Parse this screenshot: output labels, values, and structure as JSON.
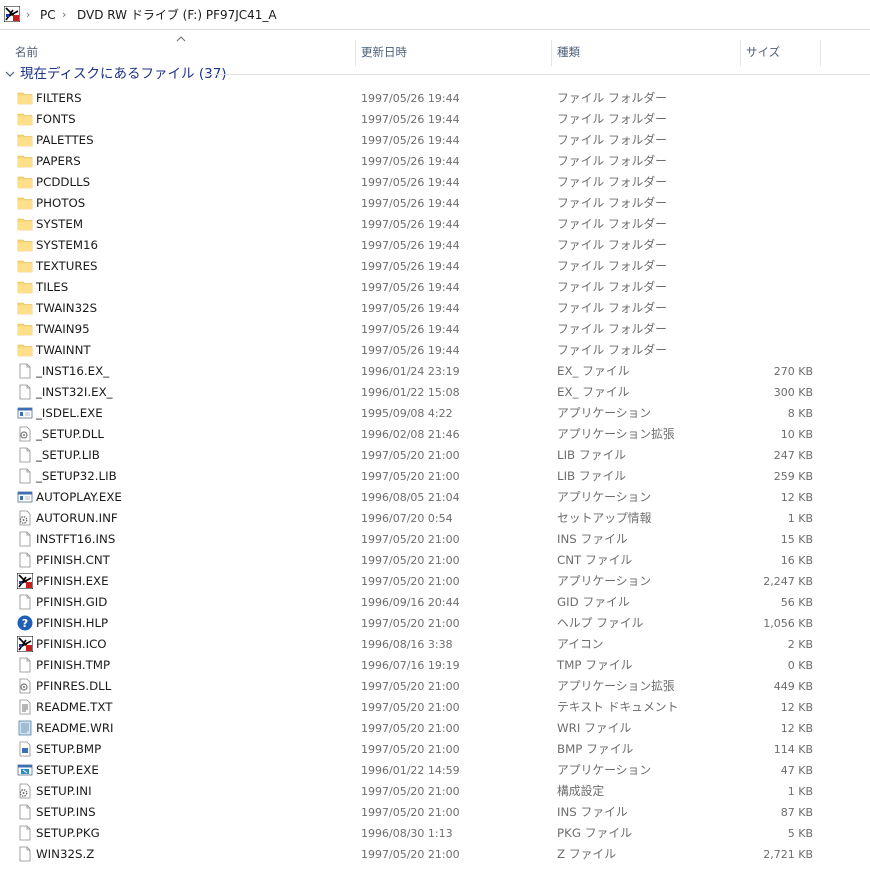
{
  "address": {
    "crumbs": [
      "PC",
      "DVD RW ドライブ (F:) PF97JC41_A"
    ]
  },
  "columns": {
    "name": "名前",
    "modified": "更新日時",
    "type": "種類",
    "size": "サイズ"
  },
  "group": {
    "title": "現在ディスクにあるファイル (37)"
  },
  "files": [
    {
      "name": "FILTERS",
      "date": "1997/05/26 19:44",
      "type": "ファイル フォルダー",
      "size": "",
      "icon": "folder"
    },
    {
      "name": "FONTS",
      "date": "1997/05/26 19:44",
      "type": "ファイル フォルダー",
      "size": "",
      "icon": "folder"
    },
    {
      "name": "PALETTES",
      "date": "1997/05/26 19:44",
      "type": "ファイル フォルダー",
      "size": "",
      "icon": "folder"
    },
    {
      "name": "PAPERS",
      "date": "1997/05/26 19:44",
      "type": "ファイル フォルダー",
      "size": "",
      "icon": "folder"
    },
    {
      "name": "PCDDLLS",
      "date": "1997/05/26 19:44",
      "type": "ファイル フォルダー",
      "size": "",
      "icon": "folder"
    },
    {
      "name": "PHOTOS",
      "date": "1997/05/26 19:44",
      "type": "ファイル フォルダー",
      "size": "",
      "icon": "folder"
    },
    {
      "name": "SYSTEM",
      "date": "1997/05/26 19:44",
      "type": "ファイル フォルダー",
      "size": "",
      "icon": "folder"
    },
    {
      "name": "SYSTEM16",
      "date": "1997/05/26 19:44",
      "type": "ファイル フォルダー",
      "size": "",
      "icon": "folder"
    },
    {
      "name": "TEXTURES",
      "date": "1997/05/26 19:44",
      "type": "ファイル フォルダー",
      "size": "",
      "icon": "folder"
    },
    {
      "name": "TILES",
      "date": "1997/05/26 19:44",
      "type": "ファイル フォルダー",
      "size": "",
      "icon": "folder"
    },
    {
      "name": "TWAIN32S",
      "date": "1997/05/26 19:44",
      "type": "ファイル フォルダー",
      "size": "",
      "icon": "folder"
    },
    {
      "name": "TWAIN95",
      "date": "1997/05/26 19:44",
      "type": "ファイル フォルダー",
      "size": "",
      "icon": "folder"
    },
    {
      "name": "TWAINNT",
      "date": "1997/05/26 19:44",
      "type": "ファイル フォルダー",
      "size": "",
      "icon": "folder"
    },
    {
      "name": "_INST16.EX_",
      "date": "1996/01/24 23:19",
      "type": "EX_ ファイル",
      "size": "270 KB",
      "icon": "file"
    },
    {
      "name": "_INST32I.EX_",
      "date": "1996/01/22 15:08",
      "type": "EX_ ファイル",
      "size": "300 KB",
      "icon": "file"
    },
    {
      "name": "_ISDEL.EXE",
      "date": "1995/09/08 4:22",
      "type": "アプリケーション",
      "size": "8 KB",
      "icon": "app"
    },
    {
      "name": "_SETUP.DLL",
      "date": "1996/02/08 21:46",
      "type": "アプリケーション拡張",
      "size": "10 KB",
      "icon": "dll"
    },
    {
      "name": "_SETUP.LIB",
      "date": "1997/05/20 21:00",
      "type": "LIB ファイル",
      "size": "247 KB",
      "icon": "file"
    },
    {
      "name": "_SETUP32.LIB",
      "date": "1997/05/20 21:00",
      "type": "LIB ファイル",
      "size": "259 KB",
      "icon": "file"
    },
    {
      "name": "AUTOPLAY.EXE",
      "date": "1996/08/05 21:04",
      "type": "アプリケーション",
      "size": "12 KB",
      "icon": "app"
    },
    {
      "name": "AUTORUN.INF",
      "date": "1996/07/20 0:54",
      "type": "セットアップ情報",
      "size": "1 KB",
      "icon": "inf"
    },
    {
      "name": "INSTFT16.INS",
      "date": "1997/05/20 21:00",
      "type": "INS ファイル",
      "size": "15 KB",
      "icon": "file"
    },
    {
      "name": "PFINISH.CNT",
      "date": "1997/05/20 21:00",
      "type": "CNT ファイル",
      "size": "16 KB",
      "icon": "file"
    },
    {
      "name": "PFINISH.EXE",
      "date": "1997/05/20 21:00",
      "type": "アプリケーション",
      "size": "2,247 KB",
      "icon": "pfinish"
    },
    {
      "name": "PFINISH.GID",
      "date": "1996/09/16 20:44",
      "type": "GID ファイル",
      "size": "56 KB",
      "icon": "file"
    },
    {
      "name": "PFINISH.HLP",
      "date": "1997/05/20 21:00",
      "type": "ヘルプ ファイル",
      "size": "1,056 KB",
      "icon": "help"
    },
    {
      "name": "PFINISH.ICO",
      "date": "1996/08/16 3:38",
      "type": "アイコン",
      "size": "2 KB",
      "icon": "pfinish"
    },
    {
      "name": "PFINISH.TMP",
      "date": "1996/07/16 19:19",
      "type": "TMP ファイル",
      "size": "0 KB",
      "icon": "file"
    },
    {
      "name": "PFINRES.DLL",
      "date": "1997/05/20 21:00",
      "type": "アプリケーション拡張",
      "size": "449 KB",
      "icon": "dll"
    },
    {
      "name": "README.TXT",
      "date": "1997/05/20 21:00",
      "type": "テキスト ドキュメント",
      "size": "12 KB",
      "icon": "text"
    },
    {
      "name": "README.WRI",
      "date": "1997/05/20 21:00",
      "type": "WRI ファイル",
      "size": "12 KB",
      "icon": "wri"
    },
    {
      "name": "SETUP.BMP",
      "date": "1997/05/20 21:00",
      "type": "BMP ファイル",
      "size": "114 KB",
      "icon": "bmp"
    },
    {
      "name": "SETUP.EXE",
      "date": "1996/01/22 14:59",
      "type": "アプリケーション",
      "size": "47 KB",
      "icon": "setup"
    },
    {
      "name": "SETUP.INI",
      "date": "1997/05/20 21:00",
      "type": "構成設定",
      "size": "1 KB",
      "icon": "inf"
    },
    {
      "name": "SETUP.INS",
      "date": "1997/05/20 21:00",
      "type": "INS ファイル",
      "size": "87 KB",
      "icon": "file"
    },
    {
      "name": "SETUP.PKG",
      "date": "1996/08/30 1:13",
      "type": "PKG ファイル",
      "size": "5 KB",
      "icon": "file"
    },
    {
      "name": "WIN32S.Z",
      "date": "1997/05/20 21:00",
      "type": "Z ファイル",
      "size": "2,721 KB",
      "icon": "file"
    }
  ]
}
